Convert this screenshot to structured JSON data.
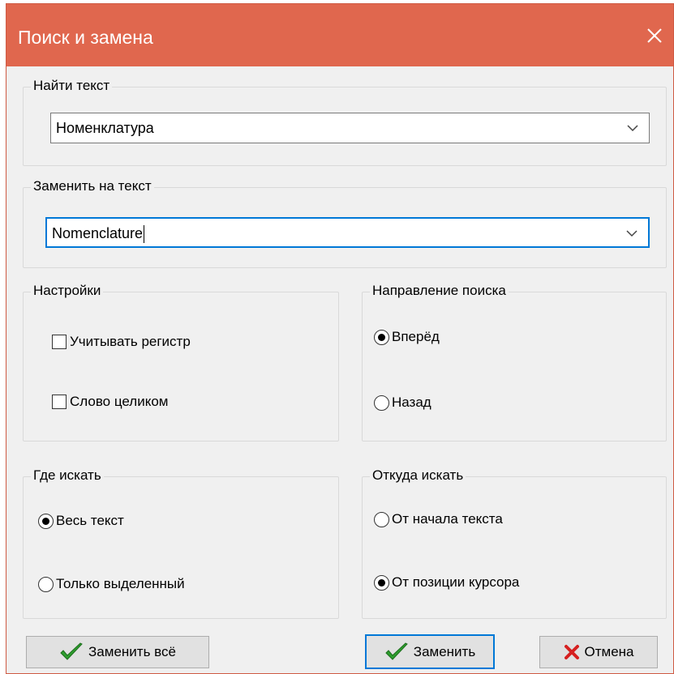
{
  "window": {
    "title": "Поиск и замена"
  },
  "find": {
    "legend": "Найти текст",
    "value": "Номенклатура"
  },
  "replace": {
    "legend": "Заменить на  текст",
    "value": "Nomenclature"
  },
  "settings": {
    "legend": "Настройки",
    "match_case": {
      "label": "Учитывать регистр",
      "checked": false
    },
    "whole_word": {
      "label": "Слово целиком",
      "checked": false
    }
  },
  "direction": {
    "legend": "Направление поиска",
    "forward": {
      "label": "Вперёд",
      "selected": true
    },
    "backward": {
      "label": "Назад",
      "selected": false
    }
  },
  "where": {
    "legend": "Где искать",
    "all_text": {
      "label": "Весь текст",
      "selected": true
    },
    "selection_only": {
      "label": "Только выделенный",
      "selected": false
    }
  },
  "origin": {
    "legend": "Откуда искать",
    "from_start": {
      "label": "От начала текста",
      "selected": false
    },
    "from_cursor": {
      "label": "От позиции курсора",
      "selected": true
    }
  },
  "buttons": {
    "replace_all": "Заменить всё",
    "replace": "Заменить",
    "cancel": "Отмена"
  },
  "colors": {
    "titlebar": "#e0674e",
    "focus_border": "#0078d7",
    "check_icon": "#2e9e2e",
    "cancel_icon": "#d62020"
  },
  "icons": {
    "close": "close-icon",
    "dropdown": "chevron-down-icon",
    "replace_all": "green-checkmark-icon",
    "replace": "green-checkmark-icon",
    "cancel": "red-x-icon"
  }
}
